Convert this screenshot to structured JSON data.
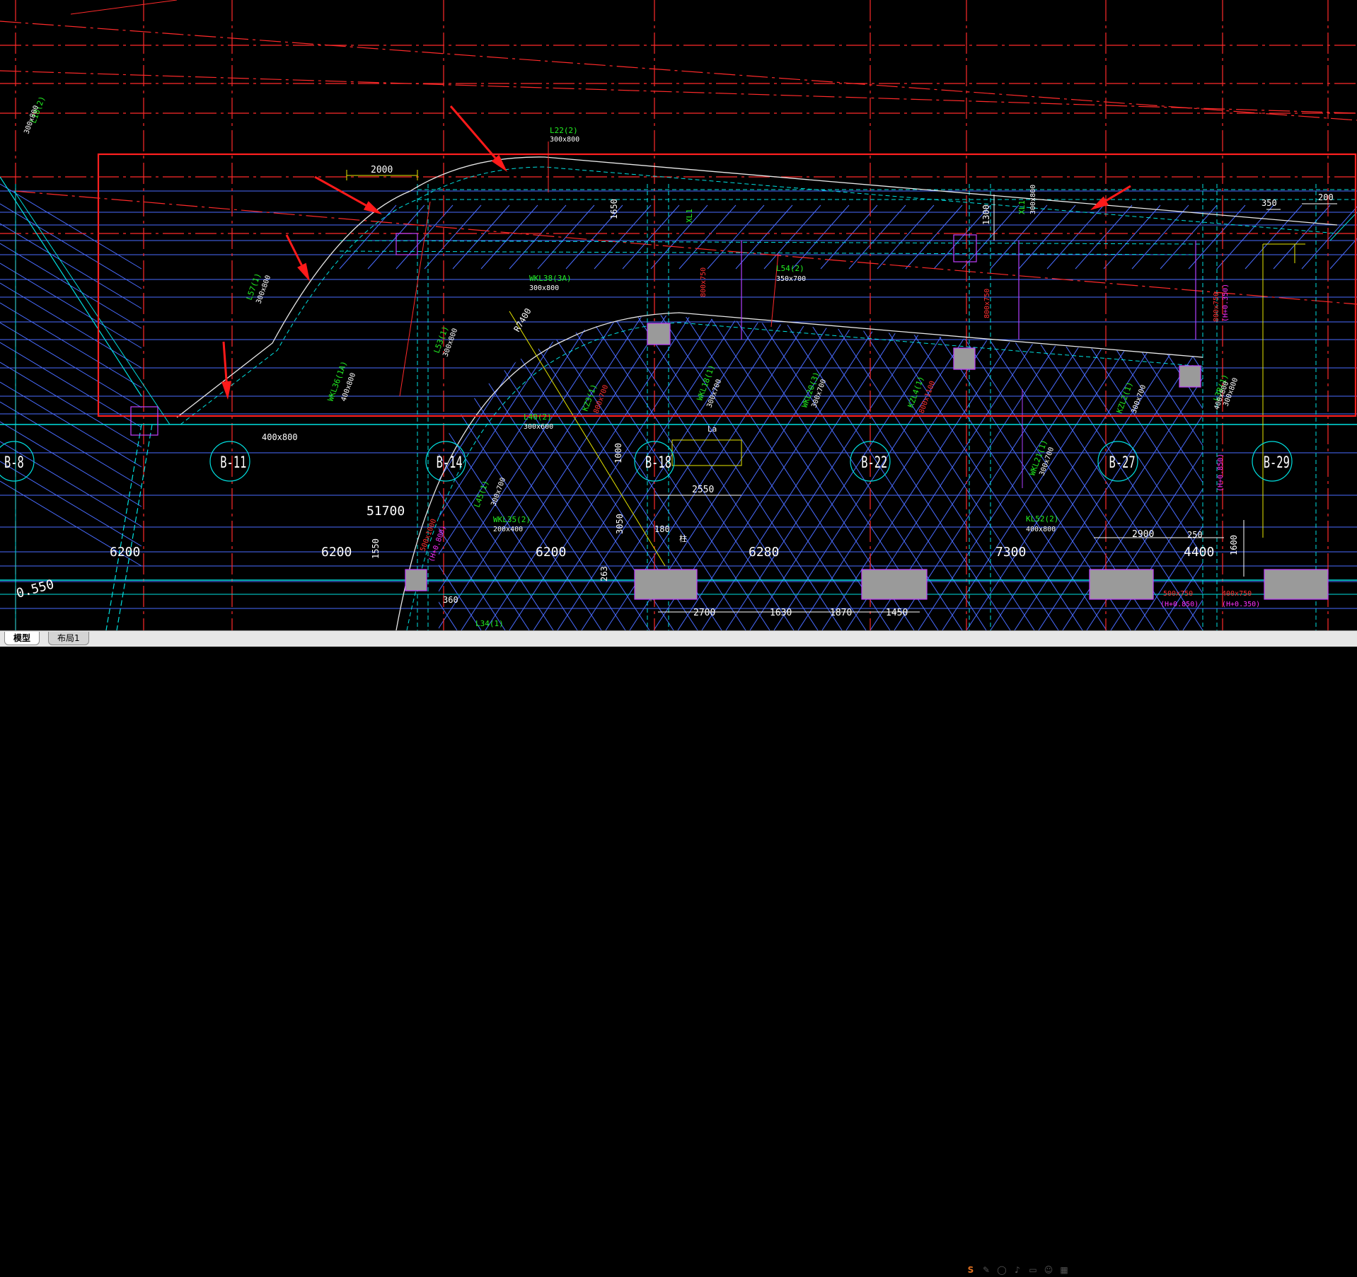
{
  "tabs": [
    {
      "label": "模型",
      "active": true
    },
    {
      "label": "布局1",
      "active": false
    }
  ],
  "status_icons": [
    "app-logo-icon",
    "pen-icon",
    "circle-icon",
    "mic-icon",
    "keyboard-icon",
    "user-icon",
    "grid-icon"
  ],
  "colors": {
    "background": "#000000",
    "grid_axis": "#ff2a2a",
    "beam_line": "#4a6cff",
    "beam_edge": "#00e0e0",
    "label_green": "#22ee22",
    "label_white": "#ffffff",
    "label_red": "#ff3030",
    "label_magenta": "#ff30ff",
    "column_fill": "#9a9a9a",
    "highlight_box": "#ff2020",
    "curve": "#e8e8e8",
    "yellow": "#e8e800"
  },
  "drawing": {
    "axis_bubbles": [
      "B-8",
      "B-11",
      "B-14",
      "B-18",
      "B-22",
      "B-27",
      "B-29"
    ],
    "dimensions": [
      "2000",
      "1650",
      "1300",
      "350",
      "200",
      "400x800",
      "51700",
      "6200",
      "6200",
      "6200",
      "6280",
      "7300",
      "4400",
      "1550",
      "3050",
      "2550",
      "1000",
      "180",
      "263",
      "360",
      "2900",
      "250",
      "1600",
      "2700",
      "1630",
      "1870",
      "1450",
      "0.550"
    ],
    "labels_green": [
      "L18(2)",
      "L22(2)",
      "L57(1)",
      "WKL38(3A)",
      "WKL36(1A)",
      "L53(1)",
      "L40(2)",
      "KZ3(1)",
      "WKL18(1)",
      "WKL20(3)",
      "KZL4(1)",
      "KZL2(1)",
      "L38(1)",
      "XL1",
      "WKL21(1)",
      "KL52(2)",
      "L45(1)",
      "WKL35(2)",
      "L54(2)",
      "L34(1)",
      "XL1"
    ],
    "labels_white": [
      "300x800",
      "300x800",
      "300x800",
      "300x800",
      "400x800",
      "300x800",
      "300x600",
      "300x700",
      "300x700",
      "300x700",
      "300x700",
      "200x400",
      "350x700",
      "300x800",
      "400x800",
      "300x800",
      "300x700",
      "400x800"
    ],
    "labels_red": [
      "800x750",
      "800x750",
      "800x700",
      "800x750",
      "800x1100",
      "400x750",
      "500x750",
      "500x1000"
    ],
    "labels_magenta": [
      "(H+0.350)",
      "(H+0.350)",
      "(H+0.800)",
      "(H+0.850)",
      "(H+0.850)"
    ],
    "misc": [
      "R7400",
      "La",
      "柱"
    ]
  }
}
